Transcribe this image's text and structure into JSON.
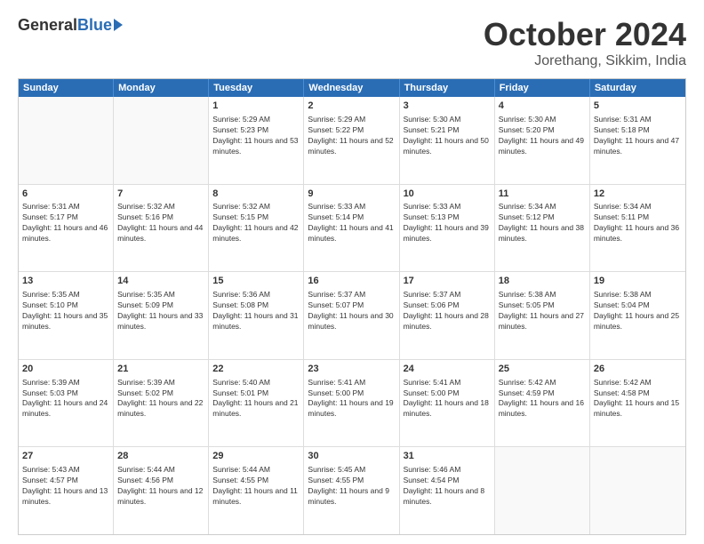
{
  "header": {
    "logo": {
      "general": "General",
      "blue": "Blue"
    },
    "title": "October 2024",
    "location": "Jorethang, Sikkim, India"
  },
  "weekdays": [
    "Sunday",
    "Monday",
    "Tuesday",
    "Wednesday",
    "Thursday",
    "Friday",
    "Saturday"
  ],
  "weeks": [
    [
      {
        "day": "",
        "sunrise": "",
        "sunset": "",
        "daylight": ""
      },
      {
        "day": "",
        "sunrise": "",
        "sunset": "",
        "daylight": ""
      },
      {
        "day": "1",
        "sunrise": "Sunrise: 5:29 AM",
        "sunset": "Sunset: 5:23 PM",
        "daylight": "Daylight: 11 hours and 53 minutes."
      },
      {
        "day": "2",
        "sunrise": "Sunrise: 5:29 AM",
        "sunset": "Sunset: 5:22 PM",
        "daylight": "Daylight: 11 hours and 52 minutes."
      },
      {
        "day": "3",
        "sunrise": "Sunrise: 5:30 AM",
        "sunset": "Sunset: 5:21 PM",
        "daylight": "Daylight: 11 hours and 50 minutes."
      },
      {
        "day": "4",
        "sunrise": "Sunrise: 5:30 AM",
        "sunset": "Sunset: 5:20 PM",
        "daylight": "Daylight: 11 hours and 49 minutes."
      },
      {
        "day": "5",
        "sunrise": "Sunrise: 5:31 AM",
        "sunset": "Sunset: 5:18 PM",
        "daylight": "Daylight: 11 hours and 47 minutes."
      }
    ],
    [
      {
        "day": "6",
        "sunrise": "Sunrise: 5:31 AM",
        "sunset": "Sunset: 5:17 PM",
        "daylight": "Daylight: 11 hours and 46 minutes."
      },
      {
        "day": "7",
        "sunrise": "Sunrise: 5:32 AM",
        "sunset": "Sunset: 5:16 PM",
        "daylight": "Daylight: 11 hours and 44 minutes."
      },
      {
        "day": "8",
        "sunrise": "Sunrise: 5:32 AM",
        "sunset": "Sunset: 5:15 PM",
        "daylight": "Daylight: 11 hours and 42 minutes."
      },
      {
        "day": "9",
        "sunrise": "Sunrise: 5:33 AM",
        "sunset": "Sunset: 5:14 PM",
        "daylight": "Daylight: 11 hours and 41 minutes."
      },
      {
        "day": "10",
        "sunrise": "Sunrise: 5:33 AM",
        "sunset": "Sunset: 5:13 PM",
        "daylight": "Daylight: 11 hours and 39 minutes."
      },
      {
        "day": "11",
        "sunrise": "Sunrise: 5:34 AM",
        "sunset": "Sunset: 5:12 PM",
        "daylight": "Daylight: 11 hours and 38 minutes."
      },
      {
        "day": "12",
        "sunrise": "Sunrise: 5:34 AM",
        "sunset": "Sunset: 5:11 PM",
        "daylight": "Daylight: 11 hours and 36 minutes."
      }
    ],
    [
      {
        "day": "13",
        "sunrise": "Sunrise: 5:35 AM",
        "sunset": "Sunset: 5:10 PM",
        "daylight": "Daylight: 11 hours and 35 minutes."
      },
      {
        "day": "14",
        "sunrise": "Sunrise: 5:35 AM",
        "sunset": "Sunset: 5:09 PM",
        "daylight": "Daylight: 11 hours and 33 minutes."
      },
      {
        "day": "15",
        "sunrise": "Sunrise: 5:36 AM",
        "sunset": "Sunset: 5:08 PM",
        "daylight": "Daylight: 11 hours and 31 minutes."
      },
      {
        "day": "16",
        "sunrise": "Sunrise: 5:37 AM",
        "sunset": "Sunset: 5:07 PM",
        "daylight": "Daylight: 11 hours and 30 minutes."
      },
      {
        "day": "17",
        "sunrise": "Sunrise: 5:37 AM",
        "sunset": "Sunset: 5:06 PM",
        "daylight": "Daylight: 11 hours and 28 minutes."
      },
      {
        "day": "18",
        "sunrise": "Sunrise: 5:38 AM",
        "sunset": "Sunset: 5:05 PM",
        "daylight": "Daylight: 11 hours and 27 minutes."
      },
      {
        "day": "19",
        "sunrise": "Sunrise: 5:38 AM",
        "sunset": "Sunset: 5:04 PM",
        "daylight": "Daylight: 11 hours and 25 minutes."
      }
    ],
    [
      {
        "day": "20",
        "sunrise": "Sunrise: 5:39 AM",
        "sunset": "Sunset: 5:03 PM",
        "daylight": "Daylight: 11 hours and 24 minutes."
      },
      {
        "day": "21",
        "sunrise": "Sunrise: 5:39 AM",
        "sunset": "Sunset: 5:02 PM",
        "daylight": "Daylight: 11 hours and 22 minutes."
      },
      {
        "day": "22",
        "sunrise": "Sunrise: 5:40 AM",
        "sunset": "Sunset: 5:01 PM",
        "daylight": "Daylight: 11 hours and 21 minutes."
      },
      {
        "day": "23",
        "sunrise": "Sunrise: 5:41 AM",
        "sunset": "Sunset: 5:00 PM",
        "daylight": "Daylight: 11 hours and 19 minutes."
      },
      {
        "day": "24",
        "sunrise": "Sunrise: 5:41 AM",
        "sunset": "Sunset: 5:00 PM",
        "daylight": "Daylight: 11 hours and 18 minutes."
      },
      {
        "day": "25",
        "sunrise": "Sunrise: 5:42 AM",
        "sunset": "Sunset: 4:59 PM",
        "daylight": "Daylight: 11 hours and 16 minutes."
      },
      {
        "day": "26",
        "sunrise": "Sunrise: 5:42 AM",
        "sunset": "Sunset: 4:58 PM",
        "daylight": "Daylight: 11 hours and 15 minutes."
      }
    ],
    [
      {
        "day": "27",
        "sunrise": "Sunrise: 5:43 AM",
        "sunset": "Sunset: 4:57 PM",
        "daylight": "Daylight: 11 hours and 13 minutes."
      },
      {
        "day": "28",
        "sunrise": "Sunrise: 5:44 AM",
        "sunset": "Sunset: 4:56 PM",
        "daylight": "Daylight: 11 hours and 12 minutes."
      },
      {
        "day": "29",
        "sunrise": "Sunrise: 5:44 AM",
        "sunset": "Sunset: 4:55 PM",
        "daylight": "Daylight: 11 hours and 11 minutes."
      },
      {
        "day": "30",
        "sunrise": "Sunrise: 5:45 AM",
        "sunset": "Sunset: 4:55 PM",
        "daylight": "Daylight: 11 hours and 9 minutes."
      },
      {
        "day": "31",
        "sunrise": "Sunrise: 5:46 AM",
        "sunset": "Sunset: 4:54 PM",
        "daylight": "Daylight: 11 hours and 8 minutes."
      },
      {
        "day": "",
        "sunrise": "",
        "sunset": "",
        "daylight": ""
      },
      {
        "day": "",
        "sunrise": "",
        "sunset": "",
        "daylight": ""
      }
    ]
  ]
}
